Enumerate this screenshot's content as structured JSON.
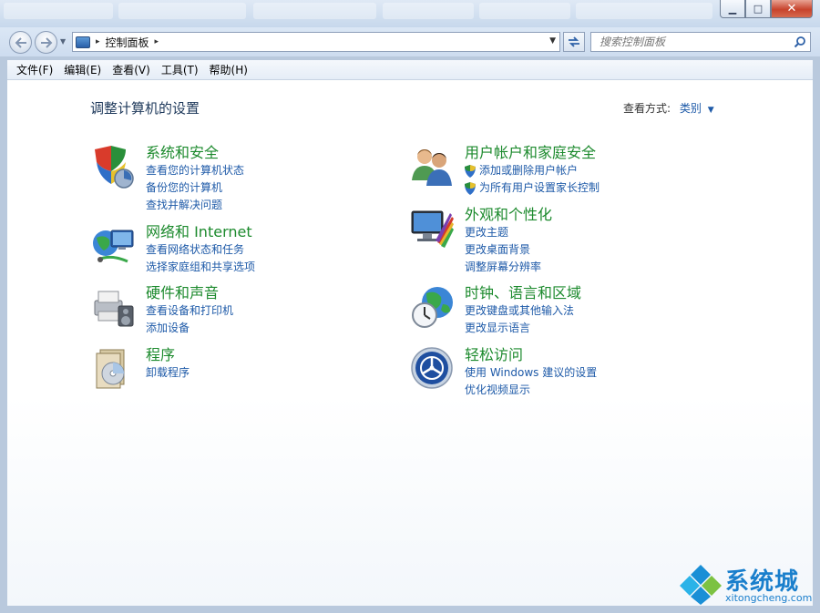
{
  "window": {
    "caption_buttons": {
      "minimize": "▁",
      "maximize": "□",
      "close": "✕"
    }
  },
  "navigation": {
    "back_icon": "back-arrow-icon",
    "forward_icon": "forward-arrow-icon",
    "address": {
      "separator": "▸",
      "location": "控制面板",
      "trailing_separator": "▸"
    },
    "search": {
      "placeholder": "搜索控制面板"
    }
  },
  "menu": {
    "items": [
      {
        "label": "文件(F)"
      },
      {
        "label": "编辑(E)"
      },
      {
        "label": "查看(V)"
      },
      {
        "label": "工具(T)"
      },
      {
        "label": "帮助(H)"
      }
    ]
  },
  "main": {
    "title": "调整计算机的设置",
    "view_by": {
      "label": "查看方式:",
      "value": "类别"
    },
    "categories": [
      {
        "title": "系统和安全",
        "icon": "system-security-icon",
        "links": [
          {
            "label": "查看您的计算机状态",
            "shield": false
          },
          {
            "label": "备份您的计算机",
            "shield": false
          },
          {
            "label": "查找并解决问题",
            "shield": false
          }
        ]
      },
      {
        "title": "网络和 Internet",
        "icon": "network-icon",
        "links": [
          {
            "label": "查看网络状态和任务",
            "shield": false
          },
          {
            "label": "选择家庭组和共享选项",
            "shield": false
          }
        ]
      },
      {
        "title": "硬件和声音",
        "icon": "hardware-sound-icon",
        "links": [
          {
            "label": "查看设备和打印机",
            "shield": false
          },
          {
            "label": "添加设备",
            "shield": false
          }
        ]
      },
      {
        "title": "程序",
        "icon": "programs-icon",
        "links": [
          {
            "label": "卸载程序",
            "shield": false
          }
        ]
      },
      {
        "title": "用户帐户和家庭安全",
        "icon": "user-accounts-icon",
        "links": [
          {
            "label": "添加或删除用户帐户",
            "shield": true
          },
          {
            "label": "为所有用户设置家长控制",
            "shield": true
          }
        ]
      },
      {
        "title": "外观和个性化",
        "icon": "appearance-icon",
        "links": [
          {
            "label": "更改主题",
            "shield": false
          },
          {
            "label": "更改桌面背景",
            "shield": false
          },
          {
            "label": "调整屏幕分辨率",
            "shield": false
          }
        ]
      },
      {
        "title": "时钟、语言和区域",
        "icon": "clock-language-region-icon",
        "links": [
          {
            "label": "更改键盘或其他输入法",
            "shield": false
          },
          {
            "label": "更改显示语言",
            "shield": false
          }
        ]
      },
      {
        "title": "轻松访问",
        "icon": "ease-of-access-icon",
        "links": [
          {
            "label": "使用 Windows 建议的设置",
            "shield": false
          },
          {
            "label": "优化视频显示",
            "shield": false
          }
        ]
      }
    ]
  },
  "watermark": {
    "chinese": "系统城",
    "english": "xitongcheng.com"
  },
  "colors": {
    "category_title": "#1c8a2d",
    "link": "#1e5aa8",
    "page_title": "#1e395b",
    "watermark": "#1a7fcc"
  }
}
